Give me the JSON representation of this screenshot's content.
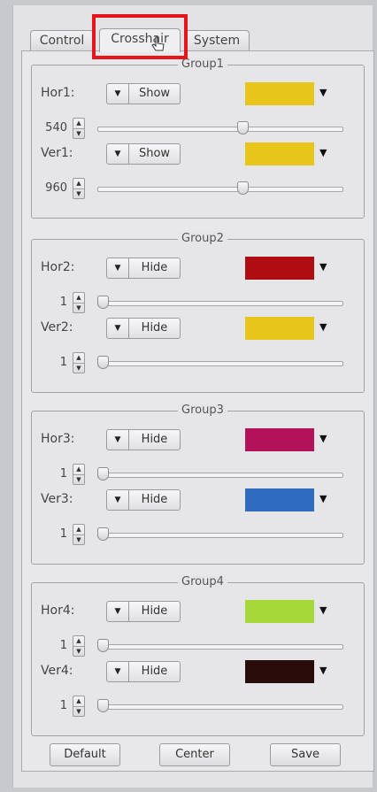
{
  "tabs": [
    "Control",
    "Crosshair",
    "System"
  ],
  "active_tab": "Crosshair",
  "groups": [
    {
      "title": "Group1",
      "rows": [
        {
          "label": "Hor1:",
          "toggle": "Show",
          "color": "#e8c51b",
          "value": "540",
          "slider_fraction": 0.6
        },
        {
          "label": "Ver1:",
          "toggle": "Show",
          "color": "#e8c51b",
          "value": "960",
          "slider_fraction": 0.6
        }
      ]
    },
    {
      "title": "Group2",
      "rows": [
        {
          "label": "Hor2:",
          "toggle": "Hide",
          "color": "#b00d12",
          "value": "1",
          "slider_fraction": 0
        },
        {
          "label": "Ver2:",
          "toggle": "Hide",
          "color": "#e8c51b",
          "value": "1",
          "slider_fraction": 0
        }
      ]
    },
    {
      "title": "Group3",
      "rows": [
        {
          "label": "Hor3:",
          "toggle": "Hide",
          "color": "#b3115a",
          "value": "1",
          "slider_fraction": 0
        },
        {
          "label": "Ver3:",
          "toggle": "Hide",
          "color": "#2f6cc0",
          "value": "1",
          "slider_fraction": 0
        }
      ]
    },
    {
      "title": "Group4",
      "rows": [
        {
          "label": "Hor4:",
          "toggle": "Hide",
          "color": "#a6d83a",
          "value": "1",
          "slider_fraction": 0
        },
        {
          "label": "Ver4:",
          "toggle": "Hide",
          "color": "#2a0d0a",
          "value": "1",
          "slider_fraction": 0
        }
      ]
    }
  ],
  "buttons": {
    "default": "Default",
    "center": "Center",
    "save": "Save"
  },
  "colors": {
    "highlight": "#e4161c",
    "panel_bg": "#e8e8eb"
  },
  "icons": {
    "dropdown": "dropdown-arrow-icon",
    "spin_up": "spin-up-icon",
    "spin_down": "spin-down-icon",
    "cursor": "hand-cursor-icon"
  }
}
